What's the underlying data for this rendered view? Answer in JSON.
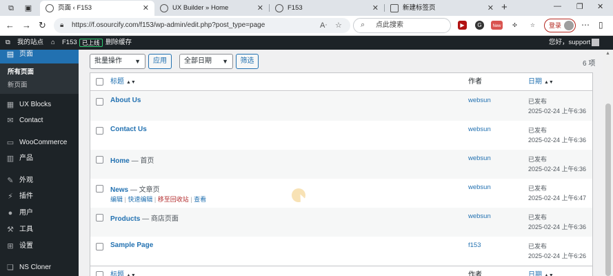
{
  "browser": {
    "tabs": [
      {
        "label": "页面 ‹ F153",
        "active": true
      },
      {
        "label": "UX Builder » Home",
        "active": false
      },
      {
        "label": "F153",
        "active": false
      },
      {
        "label": "新建标签页",
        "active": false
      }
    ],
    "url": "https://f.osourcify.com/f153/wp-admin/edit.php?post_type=page",
    "search_placeholder": "点此搜索",
    "login_label": "登录",
    "ext_badge": "New"
  },
  "adminbar": {
    "my_site": "我的站点",
    "site_name": "F153",
    "online_badge": "已上线",
    "clear_cache": "删除缓存",
    "greeting": "您好，support"
  },
  "sidebar": {
    "current": "页面",
    "submenu": [
      "所有页面",
      "新页面"
    ],
    "items": [
      {
        "label": "UX Blocks",
        "icon": "blocks-icon"
      },
      {
        "label": "Contact",
        "icon": "mail-icon"
      },
      {
        "label": "WooCommerce",
        "icon": "woo-icon"
      },
      {
        "label": "产品",
        "icon": "box-icon"
      },
      {
        "label": "外观",
        "icon": "brush-icon"
      },
      {
        "label": "插件",
        "icon": "plug-icon"
      },
      {
        "label": "用户",
        "icon": "user-icon"
      },
      {
        "label": "工具",
        "icon": "wrench-icon"
      },
      {
        "label": "设置",
        "icon": "settings-icon"
      },
      {
        "label": "NS Cloner",
        "icon": "clone-icon"
      }
    ]
  },
  "toolbar": {
    "bulk_actions": "批量操作",
    "apply": "应用",
    "all_dates": "全部日期",
    "filter": "筛选",
    "count": "6 项"
  },
  "table": {
    "headers": {
      "title": "标题",
      "author": "作者",
      "date": "日期"
    },
    "rows": [
      {
        "title": "About Us",
        "state": "",
        "author": "websun",
        "status": "已发布",
        "date": "2025-02-24 上午6:36"
      },
      {
        "title": "Contact Us",
        "state": "",
        "author": "websun",
        "status": "已发布",
        "date": "2025-02-24 上午6:36"
      },
      {
        "title": "Home",
        "state": " — 首页",
        "author": "websun",
        "status": "已发布",
        "date": "2025-02-24 上午6:36"
      },
      {
        "title": "News",
        "state": " — 文章页",
        "author": "websun",
        "status": "已发布",
        "date": "2025-02-24 上午6:47"
      },
      {
        "title": "Products",
        "state": " — 商店页面",
        "author": "websun",
        "status": "已发布",
        "date": "2025-02-24 上午6:36"
      },
      {
        "title": "Sample Page",
        "state": "",
        "author": "f153",
        "status": "已发布",
        "date": "2025-02-24 上午6:26"
      }
    ],
    "row_actions": {
      "edit": "编辑",
      "quick_edit": "快速编辑",
      "trash": "移至回收站",
      "view": "查看"
    }
  }
}
